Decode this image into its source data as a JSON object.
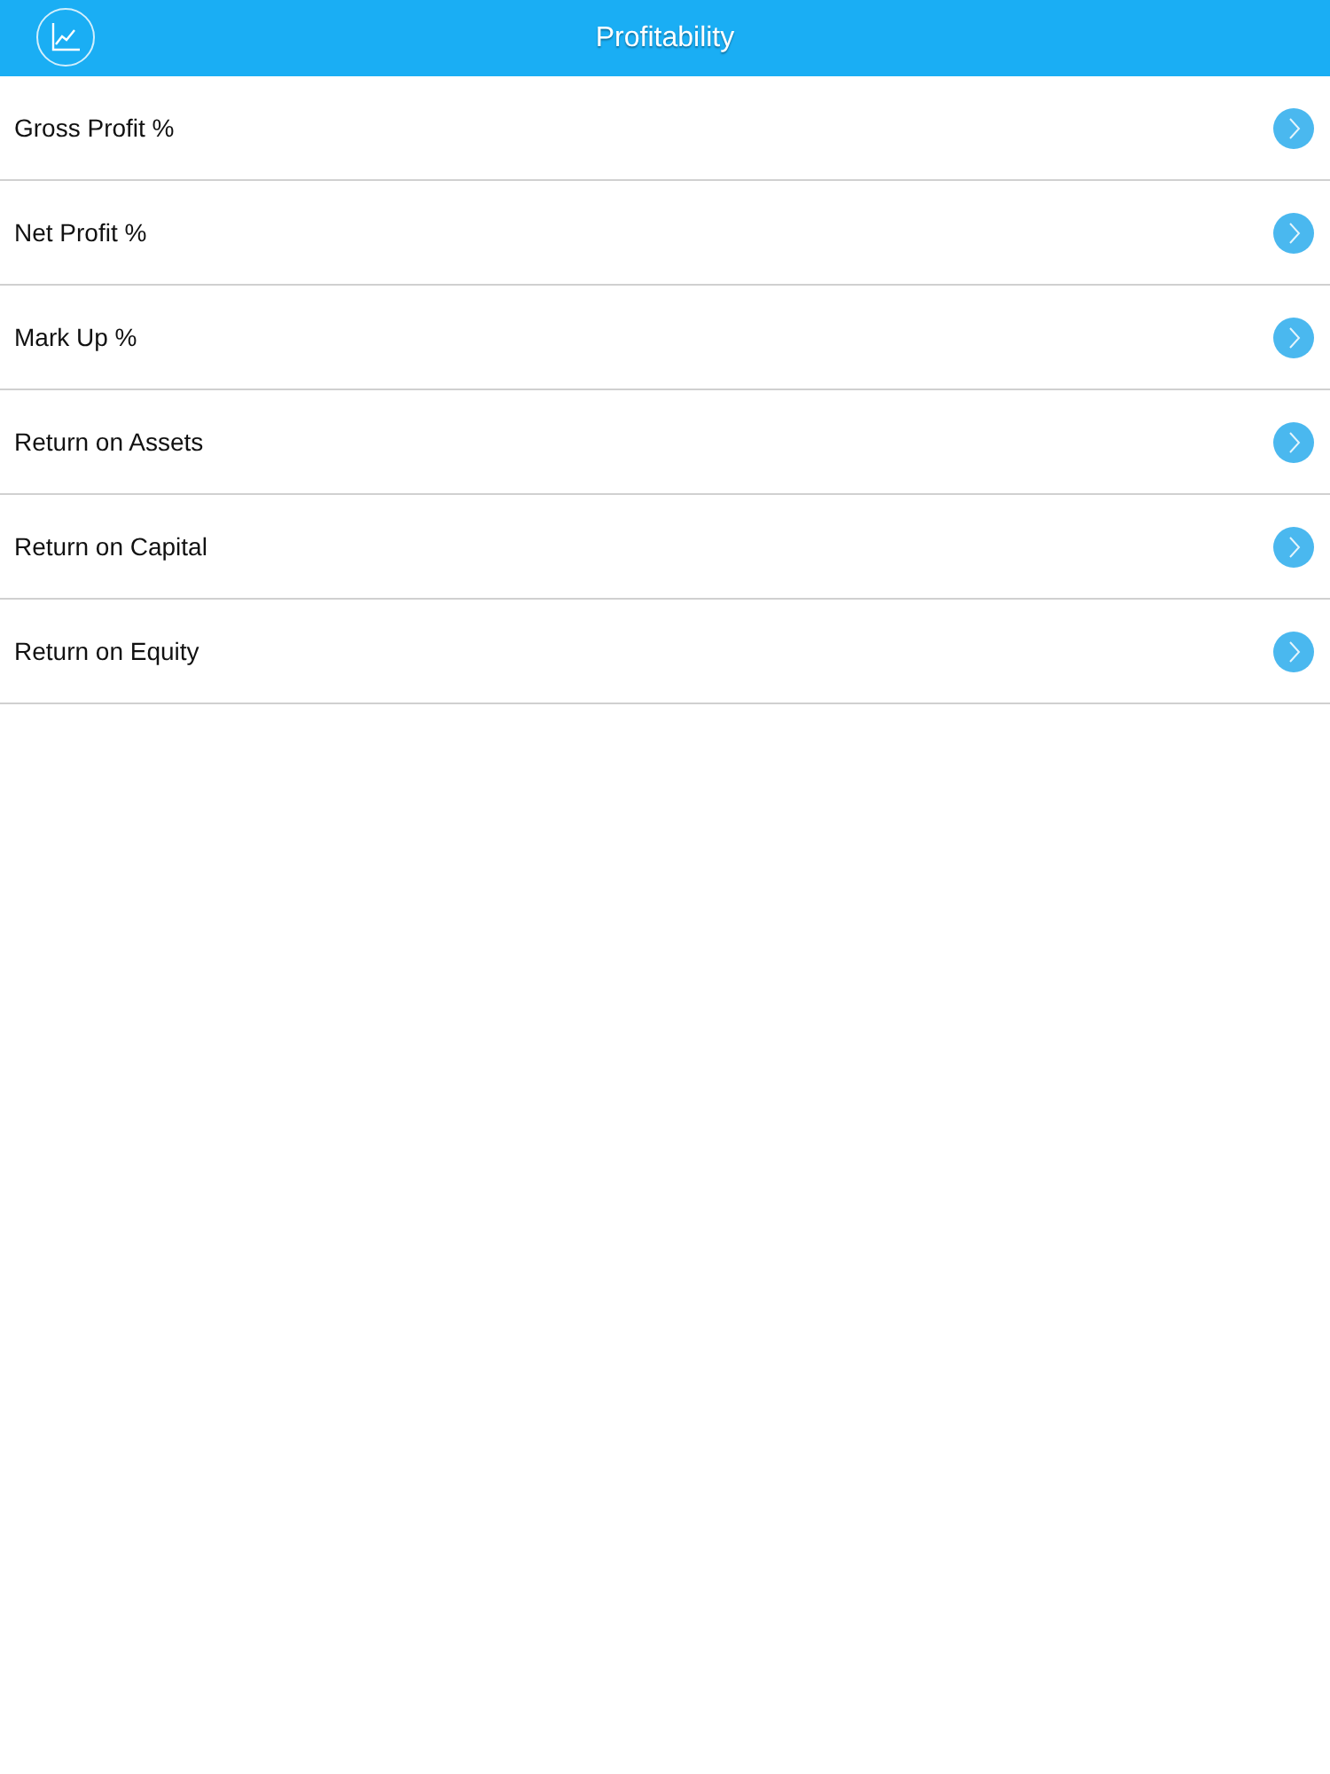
{
  "header": {
    "title": "Profitability"
  },
  "items": [
    {
      "label": "Gross Profit %"
    },
    {
      "label": "Net Profit %"
    },
    {
      "label": "Mark Up %"
    },
    {
      "label": "Return on Assets"
    },
    {
      "label": "Return on Capital"
    },
    {
      "label": "Return on Equity"
    }
  ]
}
